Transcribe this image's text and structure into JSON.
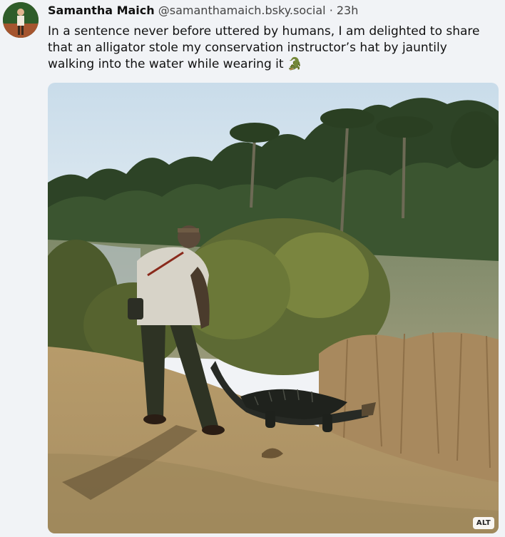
{
  "post": {
    "author_name": "Samantha Maich",
    "author_handle": "@samanthamaich.bsky.social",
    "separator": "·",
    "timestamp": "23h",
    "text": "In a sentence never before uttered by humans, I am delighted to share that an alligator stole my conservation instructor’s hat by jauntily walking into the water while wearing it 🐊",
    "image_alt_badge": "ALT",
    "avatar_icon": "profile-photo-icon",
    "colors": {
      "background": "#f1f3f6",
      "text": "#111111",
      "secondary_text": "#444444"
    }
  }
}
